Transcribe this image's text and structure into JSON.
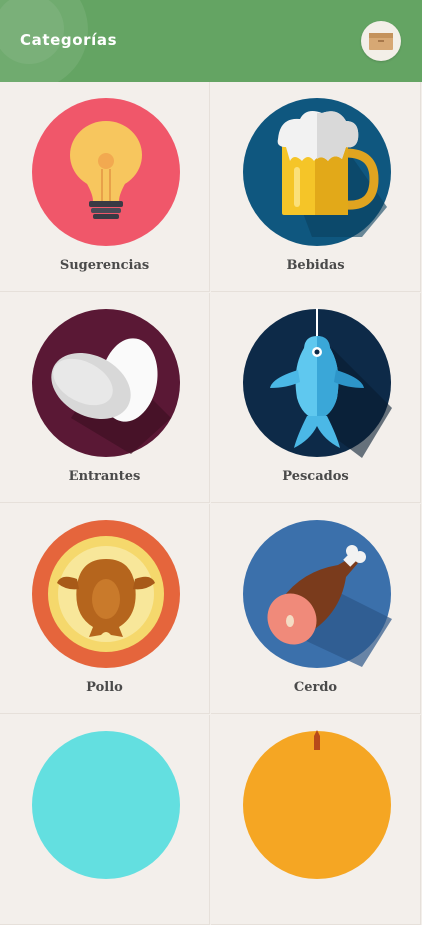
{
  "header": {
    "title": "Categorías",
    "background_color": "#64a463",
    "cart_icon": "box-icon"
  },
  "categories": [
    {
      "label": "Sugerencias",
      "icon": "lightbulb-icon",
      "color": "#f0576a"
    },
    {
      "label": "Bebidas",
      "icon": "beer-mug-icon",
      "color": "#0f577f"
    },
    {
      "label": "Entrantes",
      "icon": "eggs-icon",
      "color": "#5a1835"
    },
    {
      "label": "Pescados",
      "icon": "fish-icon",
      "color": "#0d2a48"
    },
    {
      "label": "Pollo",
      "icon": "roast-chicken-icon",
      "color": "#e5653c"
    },
    {
      "label": "Cerdo",
      "icon": "ham-icon",
      "color": "#3b70ab"
    },
    {
      "label": "",
      "icon": "cyan-category-icon",
      "color": "#63dfe0"
    },
    {
      "label": "",
      "icon": "orange-category-icon",
      "color": "#f5a623"
    }
  ]
}
